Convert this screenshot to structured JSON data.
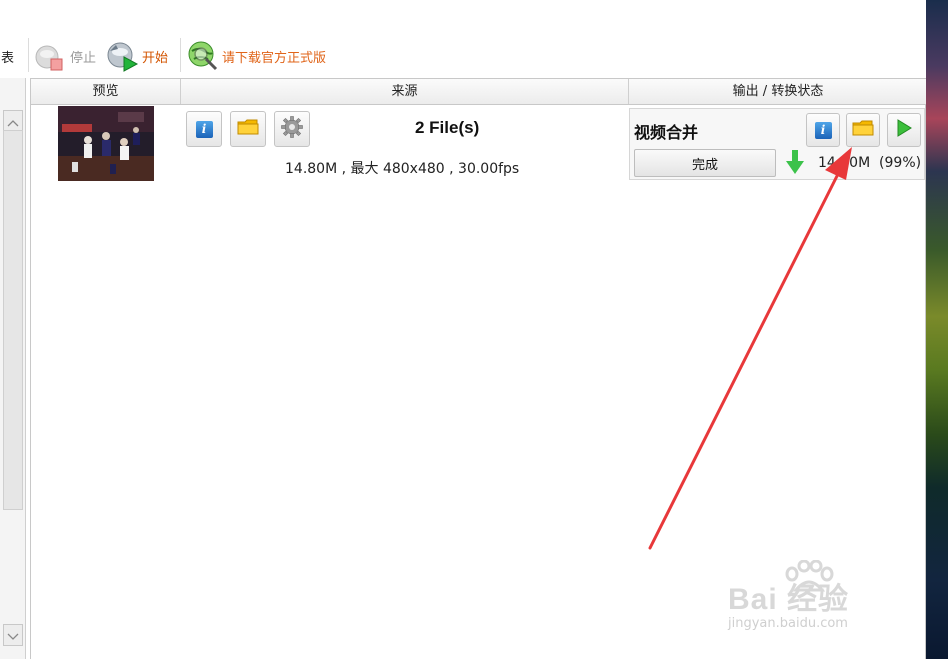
{
  "toolbar": {
    "list_label_partial": "列表",
    "stop_label": "停止",
    "start_label": "开始",
    "download_label": "请下载官方正式版"
  },
  "columns": {
    "preview": "预览",
    "source": "来源",
    "output": "输出 / 转换状态"
  },
  "item": {
    "files_title": "2 File(s)",
    "files_info": "14.80M , 最大 480x480 , 30.00fps",
    "output_title": "视频合并",
    "done_button": "完成",
    "output_status": "14.80M  (99%)",
    "progress_percent": 99
  },
  "watermark": {
    "main": "Bai 经验",
    "sub": "jingyan.baidu.com"
  },
  "colors": {
    "start_text": "#d35400",
    "download_text": "#e0651a",
    "stop_text": "#9a9a9a",
    "arrow": "#e8383a",
    "progress_arrow": "#3cc24a"
  }
}
